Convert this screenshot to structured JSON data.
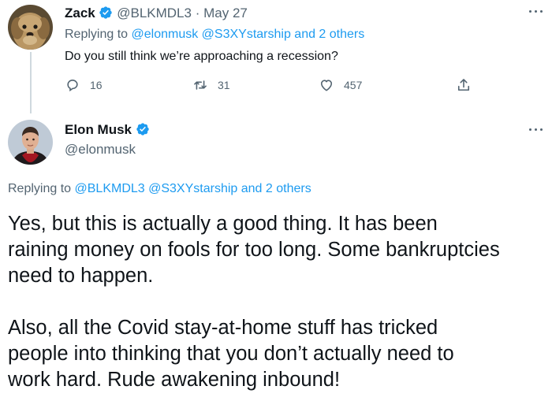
{
  "reply_tweet": {
    "author_name": "Zack",
    "handle": "@BLKMDL3",
    "separator": "·",
    "date": "May 27",
    "replying_prefix": "Replying to",
    "replying_mentions": "@elonmusk @S3XYstarship and 2 others",
    "text": "Do you still think we’re approaching a recession?",
    "stats": {
      "replies": "16",
      "retweets": "31",
      "likes": "457"
    },
    "icons": {
      "avatar": "dog-avatar",
      "verified": "verified-badge-icon"
    }
  },
  "main_tweet": {
    "author_name": "Elon Musk",
    "handle": "@elonmusk",
    "replying_prefix": "Replying to",
    "replying_mentions": "@BLKMDL3 @S3XYstarship and 2 others",
    "paragraphs": [
      [
        "Yes, but this is actually a good thing. It has been",
        "raining money on fools for too long. Some bankruptcies",
        "need to happen."
      ],
      [
        "Also, all the Covid stay-at-home stuff has tricked",
        "people into thinking that you don’t actually need to",
        "work hard. Rude awakening inbound!"
      ]
    ],
    "icons": {
      "avatar": "person-avatar",
      "verified": "verified-badge-icon"
    }
  },
  "colors": {
    "accent": "#1d9bf0",
    "muted": "#536471",
    "text": "#0f1419",
    "divider": "#cfd9de"
  }
}
